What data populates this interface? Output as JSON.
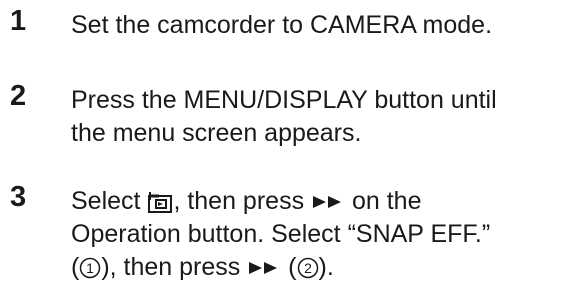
{
  "steps": [
    {
      "number": "1",
      "lines": [
        "Set the camcorder to CAMERA mode."
      ]
    },
    {
      "number": "2",
      "lines": [
        "Press the MENU/DISPLAY button until",
        "the menu screen appears."
      ]
    },
    {
      "number": "3",
      "line1_pre": "Select ",
      "line1_mid": ", then press ",
      "line1_post": " on the",
      "line2": "Operation button. Select “SNAP EFF.”",
      "line3_pre": "(",
      "line3_mid1": "), then press ",
      "line3_mid2": " (",
      "line3_post": ").",
      "circled_1": "1",
      "circled_2": "2",
      "icons": {
        "menu_item_icon": "camera-menu-icon",
        "forward_icon": "double-right-arrow-icon"
      }
    }
  ]
}
